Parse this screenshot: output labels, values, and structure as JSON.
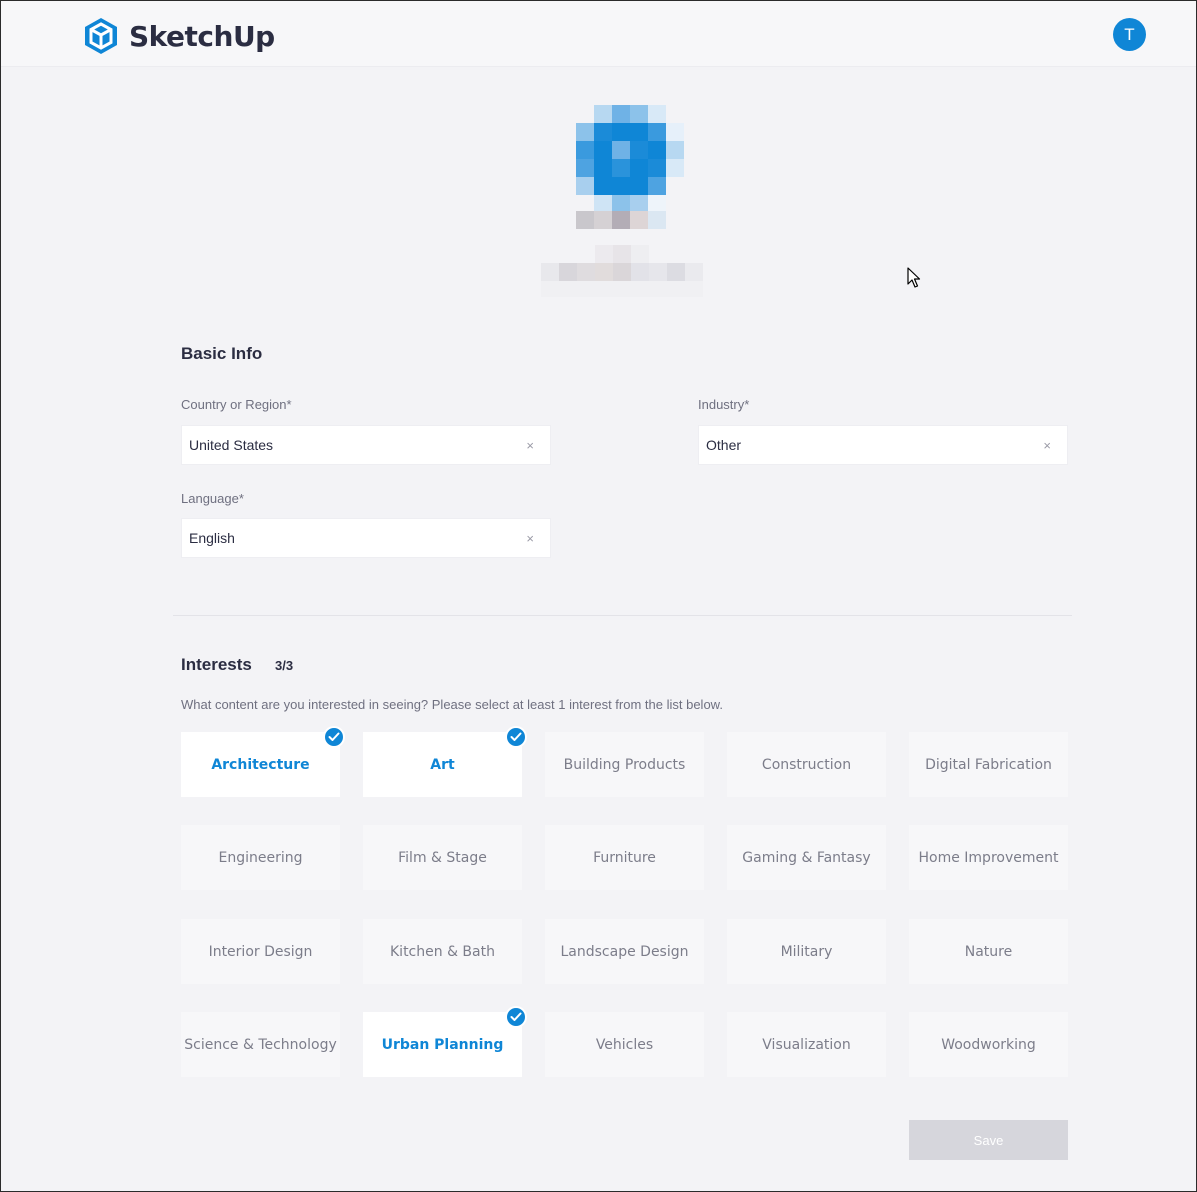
{
  "header": {
    "brand": "SketchUp",
    "avatar_initial": "T",
    "brand_color": "#0f86d6"
  },
  "basic_info": {
    "title": "Basic Info",
    "country": {
      "label": "Country or Region*",
      "value": "United States",
      "clear": "×"
    },
    "industry": {
      "label": "Industry*",
      "value": "Other",
      "clear": "×"
    },
    "language": {
      "label": "Language*",
      "value": "English",
      "clear": "×"
    }
  },
  "interests": {
    "title": "Interests",
    "count": "3/3",
    "hint": "What content are you interested in seeing? Please select at least 1 interest from the list below.",
    "items": [
      {
        "label": "Architecture",
        "selected": true
      },
      {
        "label": "Art",
        "selected": true
      },
      {
        "label": "Building Products",
        "selected": false
      },
      {
        "label": "Construction",
        "selected": false
      },
      {
        "label": "Digital Fabrication",
        "selected": false
      },
      {
        "label": "Engineering",
        "selected": false
      },
      {
        "label": "Film & Stage",
        "selected": false
      },
      {
        "label": "Furniture",
        "selected": false
      },
      {
        "label": "Gaming & Fantasy",
        "selected": false
      },
      {
        "label": "Home Improvement",
        "selected": false
      },
      {
        "label": "Interior Design",
        "selected": false
      },
      {
        "label": "Kitchen & Bath",
        "selected": false
      },
      {
        "label": "Landscape Design",
        "selected": false
      },
      {
        "label": "Military",
        "selected": false
      },
      {
        "label": "Nature",
        "selected": false
      },
      {
        "label": "Science & Technology",
        "selected": false
      },
      {
        "label": "Urban Planning",
        "selected": true
      },
      {
        "label": "Vehicles",
        "selected": false
      },
      {
        "label": "Visualization",
        "selected": false
      },
      {
        "label": "Woodworking",
        "selected": false
      }
    ]
  },
  "save_label": "Save"
}
